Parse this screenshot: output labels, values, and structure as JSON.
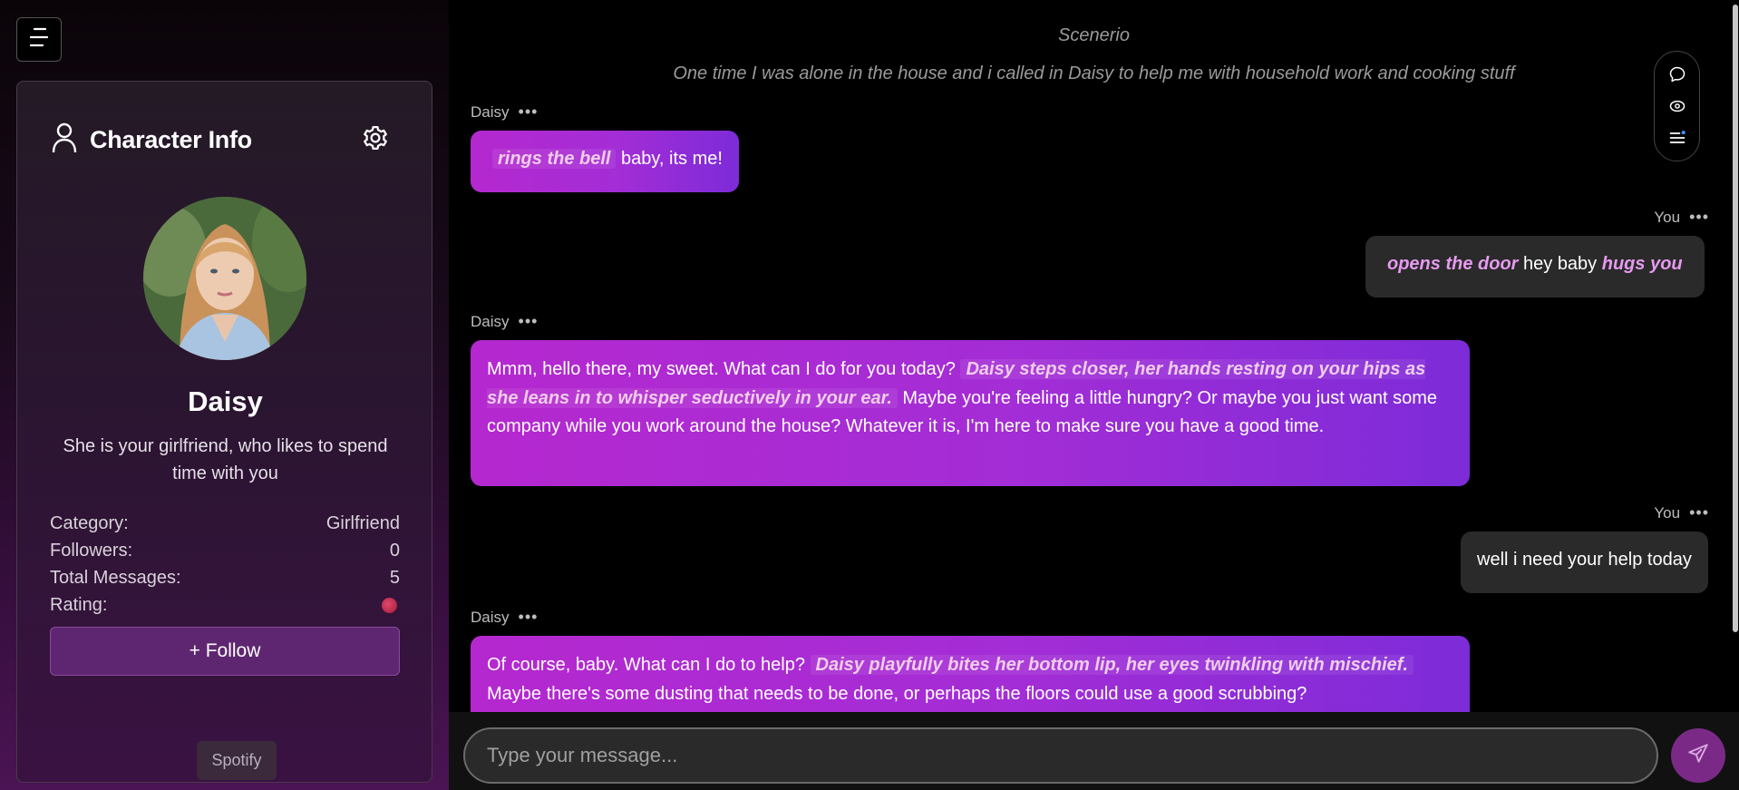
{
  "sidebar": {
    "menu_icon": "hamburger-icon",
    "header_icon": "user-icon",
    "title": "Character Info",
    "settings_icon": "gear-icon",
    "character": {
      "name": "Daisy",
      "description": "She is your girlfriend, who likes to spend time with you"
    },
    "stats": [
      {
        "label": "Category:",
        "value": "Girlfriend"
      },
      {
        "label": "Followers:",
        "value": "0"
      },
      {
        "label": "Total Messages:",
        "value": "5"
      },
      {
        "label": "Rating:",
        "value": ""
      }
    ],
    "follow_label": "+ Follow",
    "spotify_label": "Spotify"
  },
  "chat": {
    "scenario_title": "Scenerio",
    "scenario_text": "One time I was alone in the house and i called in Daisy to help me with household work and cooking stuff",
    "messages": [
      {
        "sender": "Daisy",
        "parts": [
          "rings the bell",
          " baby, its me!"
        ]
      },
      {
        "sender": "You",
        "parts": [
          "opens the door",
          " hey baby ",
          "hugs you"
        ]
      },
      {
        "sender": "Daisy",
        "parts": [
          "Mmm, hello there, my sweet. What can I do for you today? ",
          "Daisy steps closer, her hands resting on your hips as she leans in to whisper seductively in your ear.",
          " Maybe you're feeling a little hungry? Or maybe you just want some company while you work around the house? Whatever it is, I'm here to make sure you have a good time."
        ]
      },
      {
        "sender": "You",
        "parts": [
          "well i need your help today"
        ]
      },
      {
        "sender": "Daisy",
        "parts": [
          "Of course, baby. What can I do to help? ",
          "Daisy playfully bites her bottom lip, her eyes twinkling with mischief.",
          " Maybe there's some dusting that needs to be done, or perhaps the floors could use a good scrubbing?"
        ]
      }
    ],
    "tools": [
      "chat-bubble-icon",
      "eye-icon",
      "list-icon"
    ]
  },
  "composer": {
    "placeholder": "Type your message...",
    "send_icon": "send-icon"
  },
  "colors": {
    "ai_bubble_start": "#b528cf",
    "ai_bubble_end": "#7d2bd8",
    "user_bubble": "#2a2a2a",
    "user_action": "#e79af0",
    "send_button": "#7a2a86"
  }
}
